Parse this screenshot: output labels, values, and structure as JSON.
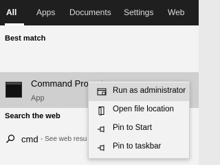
{
  "tabs": [
    {
      "label": "All",
      "active": true
    },
    {
      "label": "Apps"
    },
    {
      "label": "Documents"
    },
    {
      "label": "Settings"
    },
    {
      "label": "Web"
    }
  ],
  "best_match": {
    "heading": "Best match",
    "title": "Command Prompt",
    "subtitle": "App",
    "icon": "command-prompt-icon"
  },
  "search_web": {
    "heading": "Search the web",
    "query": "cmd",
    "hint": "- See web resu",
    "icon": "search-icon"
  },
  "context_menu": {
    "items": [
      {
        "label": "Run as administrator",
        "icon": "admin-shield-icon"
      },
      {
        "label": "Open file location",
        "icon": "file-location-icon"
      },
      {
        "label": "Pin to Start",
        "icon": "pin-icon"
      },
      {
        "label": "Pin to taskbar",
        "icon": "pin-icon"
      }
    ]
  },
  "colors": {
    "tab_bar": "#1f1f1f",
    "panel": "#f3f3f3",
    "selected_result": "#cfcfcf",
    "menu_hover": "#dadada"
  }
}
